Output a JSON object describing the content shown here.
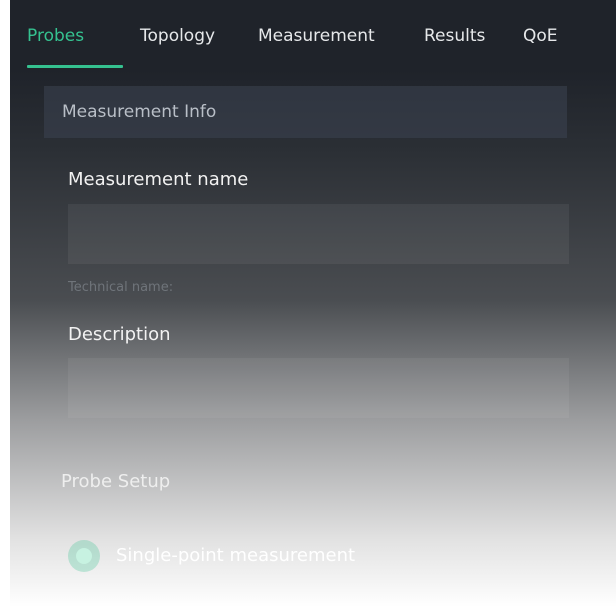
{
  "tabs": [
    {
      "label": "Probes",
      "active": true
    },
    {
      "label": "Topology",
      "active": false
    },
    {
      "label": "Measurement",
      "active": false
    },
    {
      "label": "Results",
      "active": false
    },
    {
      "label": "QoE",
      "active": false
    }
  ],
  "measurement_info": {
    "header": "Measurement Info",
    "name_label": "Measurement name",
    "name_value": "",
    "technical_name_label": "Technical name:",
    "description_label": "Description",
    "description_value": ""
  },
  "probe_setup": {
    "header": "Probe Setup",
    "options": [
      {
        "label": "Single-point measurement",
        "selected": true
      }
    ]
  },
  "colors": {
    "accent": "#35c290",
    "tab_bar_bg": "#1f232a"
  }
}
